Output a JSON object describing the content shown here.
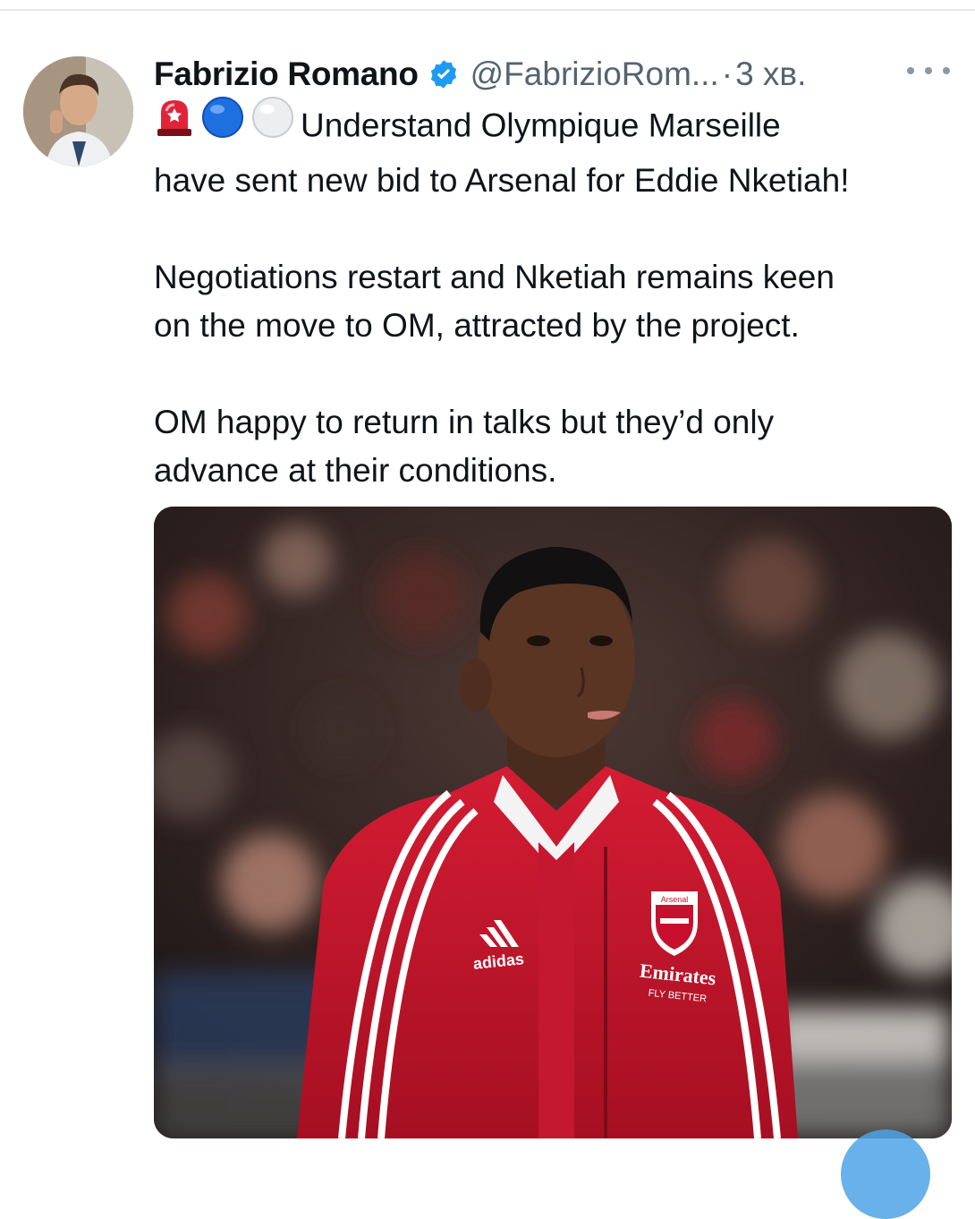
{
  "tweet": {
    "author": {
      "display_name": "Fabrizio Romano",
      "handle": "@FabrizioRom...",
      "verified": true
    },
    "separator": "·",
    "time": "3 хв.",
    "emojis": [
      "rotating-light-emoji",
      "blue-circle-emoji",
      "white-circle-emoji"
    ],
    "text_lines": [
      "Understand Olympique Marseille",
      "have sent new bid to Arsenal for Eddie Nketiah!",
      "Negotiations restart and Nketiah remains keen",
      "on the move to OM, attracted by the project.",
      "OM happy to return in talks but they’d only",
      "advance at their conditions."
    ],
    "media": {
      "jacket_brand": "adidas",
      "crest_text": "Arsenal",
      "sponsor": "Emirates",
      "sponsor_tagline": "FLY BETTER"
    }
  },
  "colors": {
    "text": "#0f1419",
    "secondary": "#536471",
    "verified": "#1d9bf0",
    "jacket_red": "#c8102e"
  }
}
